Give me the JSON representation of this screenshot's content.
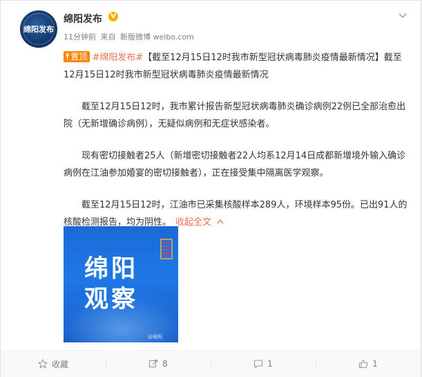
{
  "header": {
    "avatar_text": "绵阳发布",
    "nickname": "绵阳发布",
    "verified_mark": "V",
    "time": "11分钟前",
    "source_prefix": "来自",
    "source": "新版微博 weibo.com"
  },
  "post": {
    "top_tag": "置顶",
    "top_tag_icon": "pin-icon",
    "hashtag": "#绵阳发布#",
    "para1_rest": "【截至12月15日12时我市新型冠状病毒肺炎疫情最新情况】截至12月15日12时我市新型冠状病毒肺炎疫情最新情况",
    "para2": "截至12月15日12时，我市累计报告新型冠状病毒肺炎确诊病例22例已全部治愈出院（无新增确诊病例），无疑似病例和无症状感染者。",
    "para3": "现有密切接触者25人（新增密切接触者22人均系12月14日成都新增境外输入确诊病例在江油参加婚宴的密切接触者），正在接受集中隔离医学观察。",
    "para4": "截至12月15日12时，江油市已采集核酸样本289人，环境样本95份。已出91人的核酸检测报告，均为阴性。",
    "collapse_label": "收起全文",
    "collapse_icon": "chevron-up-icon"
  },
  "image": {
    "title_line1": "绵阳",
    "title_line2": "观察",
    "watermark": "@绵阳"
  },
  "actions": {
    "favorite": "收藏",
    "repost": "8",
    "comment": "1",
    "like": "1"
  },
  "colors": {
    "accent_orange": "#ff8200",
    "link": "#eb7350",
    "verified": "#ffae00",
    "image_blue": "#1e78e6"
  }
}
